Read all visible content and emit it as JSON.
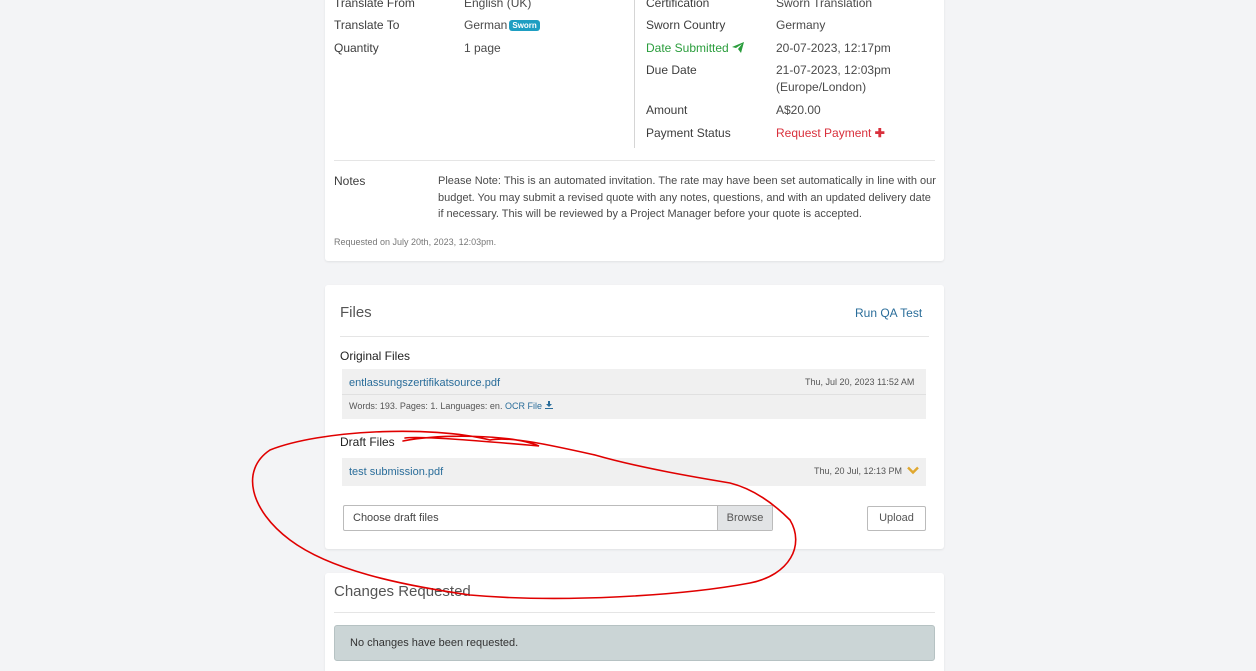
{
  "details": {
    "left": [
      {
        "label": "Translate From",
        "value": "English (UK)"
      },
      {
        "label": "Translate To",
        "value": "German",
        "badge": "Sworn"
      },
      {
        "label": "Quantity",
        "value": "1 page"
      }
    ],
    "right": [
      {
        "label": "Certification",
        "value": "Sworn Translation"
      },
      {
        "label": "Sworn Country",
        "value": "Germany"
      },
      {
        "label": "Date Submitted",
        "value": "20-07-2023, 12:17pm"
      },
      {
        "label": "Due Date",
        "value_line1": "21-07-2023, 12:03pm",
        "value_line2": "(Europe/London)"
      },
      {
        "label": "Amount",
        "value": "A$20.00"
      },
      {
        "label": "Payment Status",
        "value": "Request Payment"
      }
    ],
    "notes_label": "Notes",
    "notes_text": "Please Note: This is an automated invitation. The rate may have been set automatically in line with our budget. You may submit a revised quote with any notes, questions, and with an updated delivery date if necessary. This will be reviewed by a Project Manager before your quote is accepted.",
    "requested_on": "Requested on July 20th, 2023, 12:03pm."
  },
  "files": {
    "title": "Files",
    "qa_link": "Run QA Test",
    "original_title": "Original Files",
    "original_file": {
      "name": "entlassungszertifikatsource.pdf",
      "date": "Thu, Jul 20, 2023 11:52 AM",
      "meta": "Words: 193. Pages: 1. Languages: en.",
      "ocr_label": "OCR File"
    },
    "draft_title": "Draft Files",
    "draft_file": {
      "name": "test submission.pdf",
      "date": "Thu, 20 Jul, 12:13 PM"
    },
    "input_placeholder": "Choose draft files",
    "browse_label": "Browse",
    "upload_label": "Upload"
  },
  "changes": {
    "title": "Changes Requested",
    "message": "No changes have been requested."
  },
  "colors": {
    "annotation": "#e00000",
    "link": "#2a6d9a",
    "success": "#2a9d3c",
    "danger": "#d9303c",
    "badge": "#1e9ec2"
  }
}
